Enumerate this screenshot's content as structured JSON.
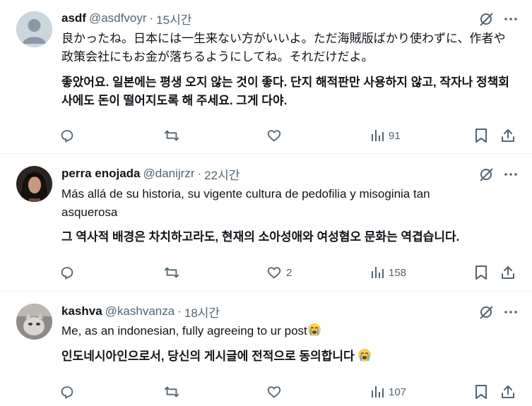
{
  "tweets": [
    {
      "name": "asdf",
      "handle": "@asdfvoyr",
      "separator": "·",
      "time": "15시간",
      "text": "良かったね。日本には一生来ない方がいいよ。ただ海賊版ばかり使わずに、作者や政策会社にもお金が落ちるようにしてね。それだけだよ。",
      "translation": "좋았어요. 일본에는 평생 오지 않는 것이 좋다. 단지 해적판만 사용하지 않고, 작자나 정책회사에도 돈이 떨어지도록 해 주세요. 그게 다야.",
      "likes": "",
      "views": "91",
      "avatar": "default"
    },
    {
      "name": "perra enojada",
      "handle": "@danijrzr",
      "separator": "·",
      "time": "22시간",
      "text": "Más allá de su historia, su vigente cultura de pedofilia y misoginia tan asquerosa",
      "translation": "그 역사적 배경은 차치하고라도, 현재의 소아성애와 여성혐오 문화는 역겹습니다.",
      "likes": "2",
      "views": "158",
      "avatar": "photo-dark"
    },
    {
      "name": "kashva",
      "handle": "@kashvanza",
      "separator": "·",
      "time": "18시간",
      "text": "Me, as an indonesian, fully agreeing to ur post",
      "translation": "인도네시아인으로서, 당신의 게시글에 전적으로 동의합니다",
      "likes": "",
      "views": "107",
      "avatar": "photo-cat"
    }
  ],
  "colors": {
    "text": "#0f1419",
    "secondary": "#536471",
    "divider": "#eff3f4"
  }
}
